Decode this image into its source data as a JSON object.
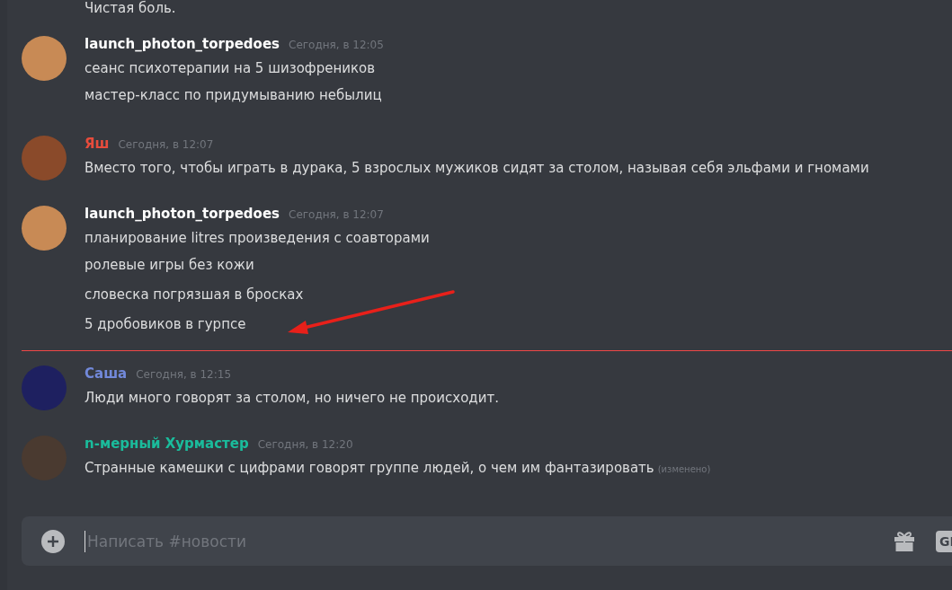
{
  "top_line": "Чистая боль.",
  "feed": [
    {
      "kind": "message",
      "author": "launch_photon_torpedoes",
      "color": "#ffffff",
      "time": "Сегодня, в 12:05",
      "lines": [
        "сеанс психотерапии на 5 шизофреников",
        "мастер-класс по придумыванию небылиц"
      ]
    },
    {
      "kind": "message",
      "author": "Яш",
      "color": "#e74c3c",
      "time": "Сегодня, в 12:07",
      "lines": [
        "Вместо того, чтобы играть в дурака, 5 взрослых мужиков сидят за столом, называя себя эльфами и гномами"
      ]
    },
    {
      "kind": "message",
      "author": "launch_photon_torpedoes",
      "color": "#ffffff",
      "time": "Сегодня, в 12:07",
      "lines": [
        "планирование litres произведения с соавторами",
        "ролевые игры без кожи",
        "словеска погрязшая в бросках",
        "5 дробовиков в гурпсе"
      ]
    },
    {
      "kind": "divider"
    },
    {
      "kind": "message",
      "author": "Саша",
      "color": "#7289da",
      "time": "Сегодня, в 12:15",
      "lines": [
        "Люди много говорят за столом, но ничего не происходит."
      ]
    },
    {
      "kind": "message",
      "author": "n-мерный Хурмастер",
      "color": "#1abc9c",
      "time": "Сегодня, в 12:20",
      "lines": [
        "Странные камешки с цифрами говорят группе людей, о чем им фантазировать"
      ],
      "edited": "(изменено)"
    }
  ],
  "composer": {
    "placeholder": "Написать #новости",
    "gif_label": "GI"
  }
}
